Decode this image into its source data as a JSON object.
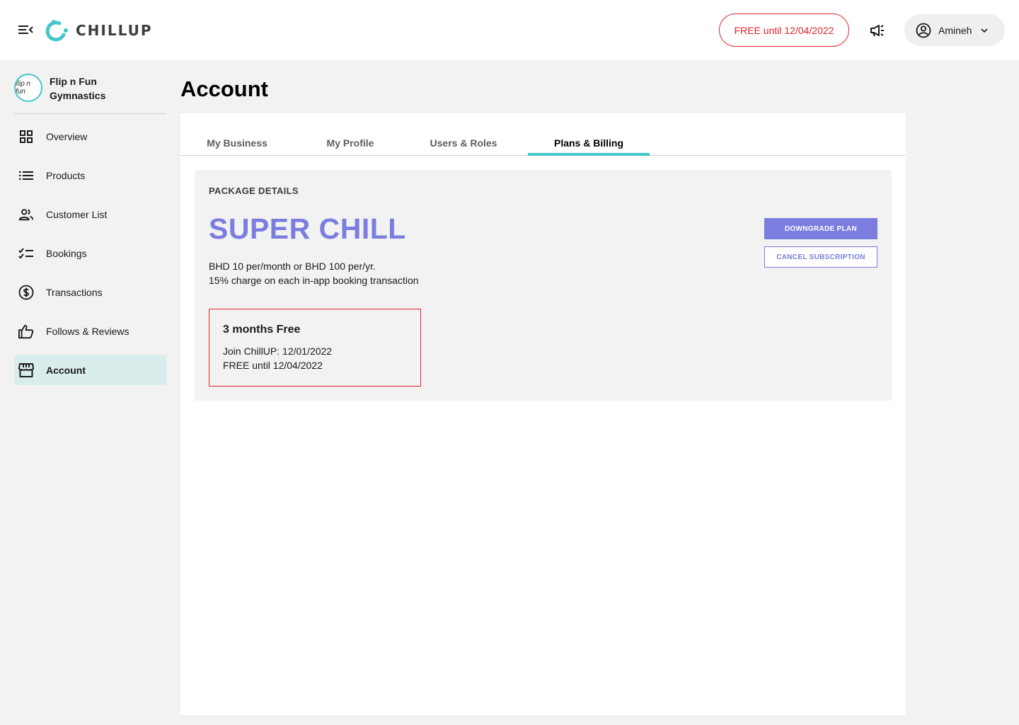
{
  "header": {
    "logo_text": "CHILLUP",
    "free_badge": "FREE until 12/04/2022",
    "user_name": "Amineh"
  },
  "sidebar": {
    "business_name": "Flip n Fun Gymnastics",
    "business_logo_text": "flip n fun",
    "items": [
      {
        "label": "Overview",
        "icon": "grid-icon"
      },
      {
        "label": "Products",
        "icon": "list-icon"
      },
      {
        "label": "Customer List",
        "icon": "people-icon"
      },
      {
        "label": "Bookings",
        "icon": "checklist-icon"
      },
      {
        "label": "Transactions",
        "icon": "dollar-icon"
      },
      {
        "label": "Follows & Reviews",
        "icon": "thumbs-up-icon"
      },
      {
        "label": "Account",
        "icon": "store-icon",
        "active": true
      }
    ]
  },
  "main": {
    "title": "Account",
    "tabs": [
      {
        "label": "My Business"
      },
      {
        "label": "My Profile"
      },
      {
        "label": "Users & Roles"
      },
      {
        "label": "Plans & Billing",
        "active": true
      }
    ],
    "package": {
      "section_label": "PACKAGE DETAILS",
      "plan_name": "SUPER CHILL",
      "price_line": "BHD 10 per/month or BHD 100 per/yr.",
      "charge_line": "15% charge on each in-app booking transaction",
      "downgrade_label": "DOWNGRADE PLAN",
      "cancel_label": "CANCEL SUBSCRIPTION",
      "free_offer": {
        "title": "3 months Free",
        "join_line": "Join ChillUP: 12/01/2022",
        "free_line": "FREE until 12/04/2022"
      }
    }
  },
  "colors": {
    "accent_teal": "#45c6c9",
    "plan_purple": "#7b7ddf",
    "alert_red": "#e0262c",
    "active_nav_bg": "#d9edec"
  }
}
